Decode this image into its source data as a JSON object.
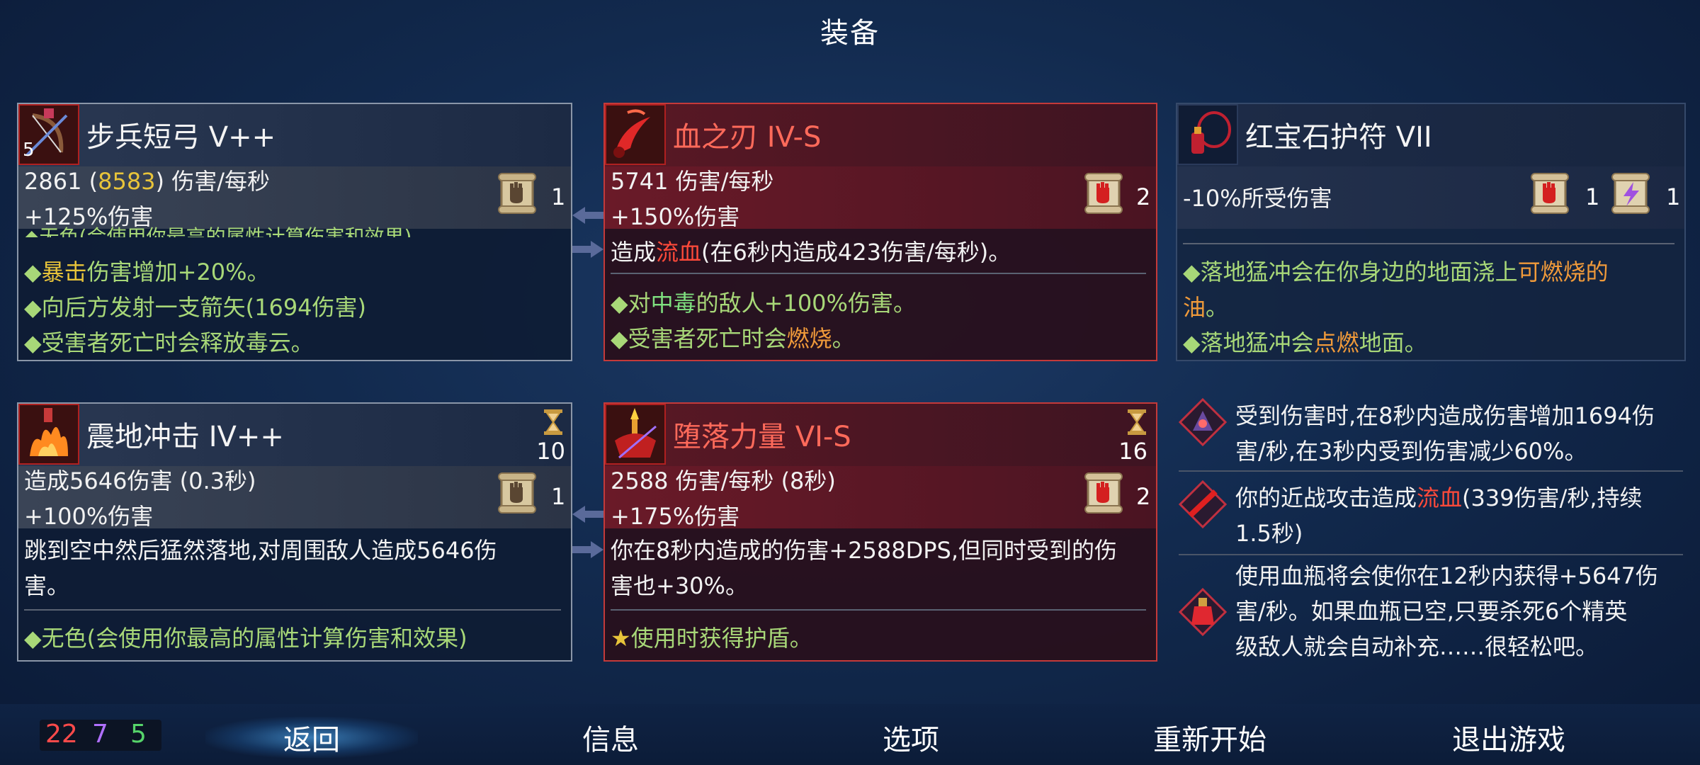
{
  "title": "装备",
  "cards": {
    "bow": {
      "name": "步兵短弓  V++",
      "level": "5",
      "dps": "2861",
      "dps_alt": "8583",
      "dps_suffix": "伤害/每秒",
      "damage_bonus": "+125%伤害",
      "scroll_count": "1",
      "effect_cut": "◆无色(会使用你最高的属性计算伤害和效果)",
      "effect_crit_kw": "暴击",
      "effect_crit_rest": "伤害增加+20%。",
      "effect_arrow": "◆向后方发射一支箭矢(1694伤害)",
      "effect_poison": "◆受害者死亡时会释放毒云。"
    },
    "blade": {
      "name": "血之刃  IV-S",
      "dps": "5741 伤害/每秒",
      "damage_bonus": "+150%伤害",
      "scroll_count": "2",
      "desc_pre": "造成",
      "desc_kw": "流血",
      "desc_post": "(在6秒内造成423伤害/每秒)。",
      "effect1_pre": "◆对",
      "effect1_kw": "中毒",
      "effect1_post": "的敌人+100%伤害。",
      "effect2_pre": "◆受害者死亡时会",
      "effect2_kw": "燃烧",
      "effect2_post": "。"
    },
    "amulet": {
      "name": "红宝石护符  VII",
      "stat": "-10%所受伤害",
      "scroll_red_count": "1",
      "scroll_purple_count": "1",
      "effect1_pre": "◆落地猛冲会在你身边的地面浇上",
      "effect1_kw": "可燃烧的",
      "effect1_kw2": "油",
      "effect1_post": "。",
      "effect2_pre": "◆落地猛冲会",
      "effect2_kw": "点燃",
      "effect2_post": "地面。"
    },
    "quake": {
      "name": "震地冲击  IV++",
      "cooldown": "10",
      "damage": "造成5646伤害  (0.3秒)",
      "damage_bonus": "+100%伤害",
      "scroll_count": "1",
      "desc1": "跳到空中然后猛然落地,对周围敌人造成5646伤",
      "desc2": "害。",
      "effect": "◆无色(会使用你最高的属性计算伤害和效果)"
    },
    "fallen": {
      "name": "堕落力量  VI-S",
      "cooldown": "16",
      "dps": "2588 伤害/每秒  (8秒)",
      "damage_bonus": "+175%伤害",
      "scroll_count": "2",
      "desc1": "你在8秒内造成的伤害+2588DPS,但同时受到的伤",
      "desc2": "害也+30%。",
      "effect": "使用时获得护盾。"
    }
  },
  "perks": {
    "p1_l1": "受到伤害时,在8秒内造成伤害增加1694伤",
    "p1_l2": "害/秒,在3秒内受到伤害减少60%。",
    "p2_l1_pre": "你的近战攻击造成",
    "p2_l1_kw": "流血",
    "p2_l1_post": "(339伤害/秒,持续",
    "p2_l2": "1.5秒)",
    "p3_l1": "使用血瓶将会使你在12秒内获得+5647伤",
    "p3_l2": "害/秒。如果血瓶已空,只要杀死6个精英",
    "p3_l3": "级敌人就会自动补充……很轻松吧。"
  },
  "stats": {
    "brutality": "22",
    "tactics": "7",
    "survival": "5"
  },
  "menu": {
    "back": "返回",
    "info": "信息",
    "options": "选项",
    "restart": "重新开始",
    "quit": "退出游戏"
  },
  "colors": {
    "brutality": "#ff4a4a",
    "tactics": "#b070ff",
    "survival": "#56d46a",
    "card_red_border": "#c43a3a",
    "card_grey_border": "#8a96a8",
    "keyword_gold": "#e8c43a",
    "keyword_orange": "#f09a3a",
    "keyword_red": "#ff4a3a"
  }
}
